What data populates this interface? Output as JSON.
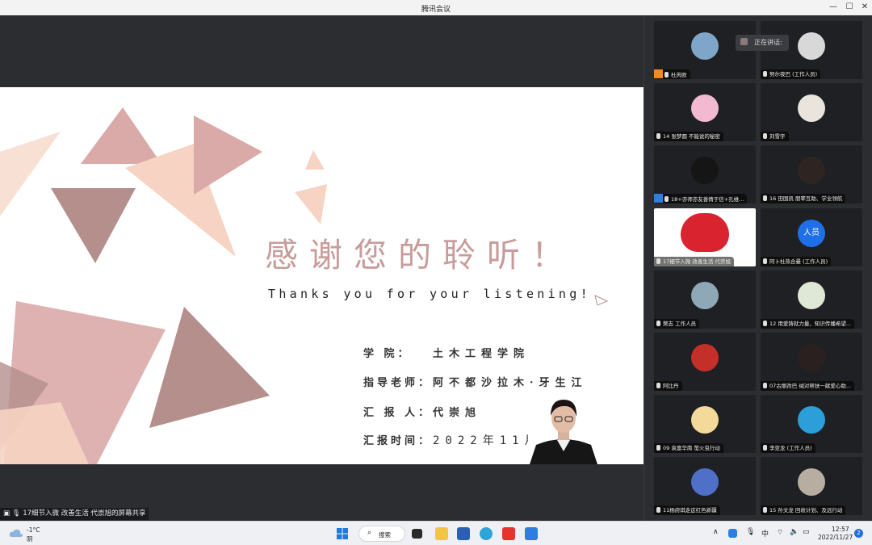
{
  "window": {
    "title": "腾讯会议",
    "controls": [
      "—",
      "☐",
      "✕"
    ]
  },
  "slide": {
    "title": "感谢您的聆听！",
    "subtitle": "Thanks you for your listening!",
    "rows": [
      {
        "label": "学  院：",
        "value": "土木工程学院"
      },
      {
        "label": "指导老师：",
        "value": "阿不都沙拉木·牙生江"
      },
      {
        "label": "汇 报 人：",
        "value": "代崇旭"
      },
      {
        "label": "汇报时间：",
        "value": "2022年11月27"
      }
    ]
  },
  "share_status": "17细节入微 改善生活 代崇旭的屏幕共享",
  "speaking_label": "正在讲话:",
  "participants": [
    {
      "name": "杜芮欧",
      "badge": "host",
      "avatar_color": "#7fa6c9"
    },
    {
      "name": "努尔夜巴 (工作人员)",
      "badge": "",
      "avatar_color": "#d8d8d8"
    },
    {
      "name": "14 张梦圆 不能说的秘密",
      "badge": "",
      "avatar_color": "#f2b9cf"
    },
    {
      "name": "刘雪宇",
      "badge": "",
      "avatar_color": "#e9e4dc"
    },
    {
      "name": "18+亦师亦友善情于信+孔维...",
      "badge": "cohost",
      "avatar_color": "#151515"
    },
    {
      "name": "16 田国凯 朋辈互助、学业领航",
      "badge": "",
      "avatar_color": "#2e2522"
    },
    {
      "name": "17细节入微 改善生活 代崇旭",
      "badge": "",
      "avatar_color": "#d9232e"
    },
    {
      "name": "阿卜杜热合曼 (工作人员)",
      "badge": "",
      "avatar_text": "人员",
      "avatar_color": "#1e6fe8"
    },
    {
      "name": "樊志 工作人员",
      "badge": "",
      "avatar_color": "#8fa8b8"
    },
    {
      "name": "12 用爱铸就力量，知识传播希望...",
      "badge": "",
      "avatar_color": "#dfe8d4"
    },
    {
      "name": "阿比丹",
      "badge": "",
      "avatar_color": "#c52f2a"
    },
    {
      "name": "07古丽孜巴 绒对帮扶一献爱心助...",
      "badge": "",
      "avatar_color": "#2a2020"
    },
    {
      "name": "09 袁富华南 萤火虫行动",
      "badge": "",
      "avatar_color": "#f3d99a"
    },
    {
      "name": "李亚龙 (工作人员)",
      "badge": "",
      "avatar_color": "#2c9ed8"
    },
    {
      "name": "11杨府琪走这红色新疆",
      "badge": "",
      "avatar_color": "#4f6fc8"
    },
    {
      "name": "15 孙文龙 回收计划、及远行动",
      "badge": "",
      "avatar_color": "#b7ada0"
    }
  ],
  "taskbar": {
    "weather_temp": "-1°C",
    "weather_desc": "阴",
    "search_label": "搜索",
    "ime": "中",
    "time": "12:57",
    "date": "2022/11/27",
    "notifications": "2"
  },
  "colors": {
    "slide_accent": "#c79c9a",
    "tri_dark": "#b48f8c",
    "tri_pink": "#d9aaa8",
    "tri_peach": "#f6d3c2",
    "speaker_bg": "#1e6fe8"
  }
}
